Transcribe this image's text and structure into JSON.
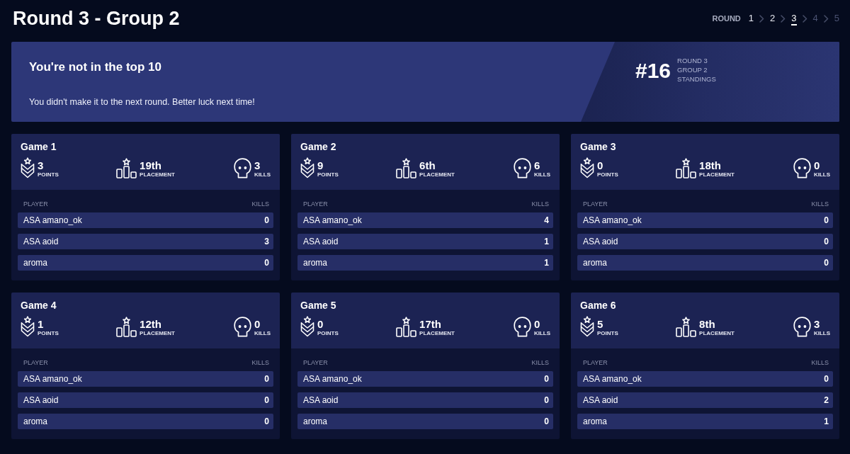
{
  "page": {
    "title": "Round 3 - Group 2"
  },
  "round_nav": {
    "label": "ROUND",
    "rounds": [
      {
        "label": "1",
        "selected": false,
        "disabled": false
      },
      {
        "label": "2",
        "selected": false,
        "disabled": false
      },
      {
        "label": "3",
        "selected": true,
        "disabled": false
      },
      {
        "label": "4",
        "selected": false,
        "disabled": true
      },
      {
        "label": "5",
        "selected": false,
        "disabled": true
      }
    ]
  },
  "banner": {
    "heading": "You're not in the top 10",
    "message": "You didn't make it to the next round. Better luck next time!",
    "rank": "#16",
    "rank_caption": [
      "ROUND 3",
      "GROUP 2",
      "STANDINGS"
    ]
  },
  "games": [
    {
      "title": "Game 1",
      "stats": [
        {
          "kind": "points",
          "value": "3",
          "label": "POINTS"
        },
        {
          "kind": "placement",
          "value": "19th",
          "label": "PLACEMENT"
        },
        {
          "kind": "kills",
          "value": "3",
          "label": "KILLS"
        }
      ],
      "columns": [
        "PLAYER",
        "KILLS"
      ],
      "rows": [
        {
          "player": "ASA amano_ok",
          "kills": "0"
        },
        {
          "player": "ASA aoid",
          "kills": "3"
        },
        {
          "player": "aroma",
          "kills": "0"
        }
      ]
    },
    {
      "title": "Game 2",
      "stats": [
        {
          "kind": "points",
          "value": "9",
          "label": "POINTS"
        },
        {
          "kind": "placement",
          "value": "6th",
          "label": "PLACEMENT"
        },
        {
          "kind": "kills",
          "value": "6",
          "label": "KILLS"
        }
      ],
      "columns": [
        "PLAYER",
        "KILLS"
      ],
      "rows": [
        {
          "player": "ASA amano_ok",
          "kills": "4"
        },
        {
          "player": "ASA aoid",
          "kills": "1"
        },
        {
          "player": "aroma",
          "kills": "1"
        }
      ]
    },
    {
      "title": "Game 3",
      "stats": [
        {
          "kind": "points",
          "value": "0",
          "label": "POINTS"
        },
        {
          "kind": "placement",
          "value": "18th",
          "label": "PLACEMENT"
        },
        {
          "kind": "kills",
          "value": "0",
          "label": "KILLS"
        }
      ],
      "columns": [
        "PLAYER",
        "KILLS"
      ],
      "rows": [
        {
          "player": "ASA amano_ok",
          "kills": "0"
        },
        {
          "player": "ASA aoid",
          "kills": "0"
        },
        {
          "player": "aroma",
          "kills": "0"
        }
      ]
    },
    {
      "title": "Game 4",
      "stats": [
        {
          "kind": "points",
          "value": "1",
          "label": "POINTS"
        },
        {
          "kind": "placement",
          "value": "12th",
          "label": "PLACEMENT"
        },
        {
          "kind": "kills",
          "value": "0",
          "label": "KILLS"
        }
      ],
      "columns": [
        "PLAYER",
        "KILLS"
      ],
      "rows": [
        {
          "player": "ASA amano_ok",
          "kills": "0"
        },
        {
          "player": "ASA aoid",
          "kills": "0"
        },
        {
          "player": "aroma",
          "kills": "0"
        }
      ]
    },
    {
      "title": "Game 5",
      "stats": [
        {
          "kind": "points",
          "value": "0",
          "label": "POINTS"
        },
        {
          "kind": "placement",
          "value": "17th",
          "label": "PLACEMENT"
        },
        {
          "kind": "kills",
          "value": "0",
          "label": "KILLS"
        }
      ],
      "columns": [
        "PLAYER",
        "KILLS"
      ],
      "rows": [
        {
          "player": "ASA amano_ok",
          "kills": "0"
        },
        {
          "player": "ASA aoid",
          "kills": "0"
        },
        {
          "player": "aroma",
          "kills": "0"
        }
      ]
    },
    {
      "title": "Game 6",
      "stats": [
        {
          "kind": "points",
          "value": "5",
          "label": "POINTS"
        },
        {
          "kind": "placement",
          "value": "8th",
          "label": "PLACEMENT"
        },
        {
          "kind": "kills",
          "value": "3",
          "label": "KILLS"
        }
      ],
      "columns": [
        "PLAYER",
        "KILLS"
      ],
      "rows": [
        {
          "player": "ASA amano_ok",
          "kills": "0"
        },
        {
          "player": "ASA aoid",
          "kills": "2"
        },
        {
          "player": "aroma",
          "kills": "1"
        }
      ]
    }
  ]
}
